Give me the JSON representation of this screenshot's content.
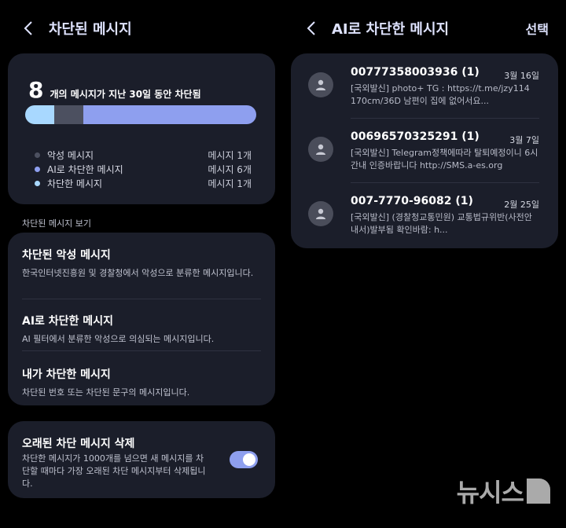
{
  "left": {
    "title": "차단된 메시지",
    "summary": {
      "count": "8",
      "count_text": "개의 메시지가 지난 30일 동안 차단됨",
      "bar_colors": {
        "spam": "#4c5060",
        "ai": "#8e9fef",
        "user": "#a8d8ff"
      },
      "bar_fractions": {
        "user": 0.125,
        "spam": 0.125,
        "ai": 0.75
      },
      "legend": [
        {
          "label": "악성 메시지",
          "count": "메시지 1개",
          "color": "#4c5060"
        },
        {
          "label": "AI로 차단한 메시지",
          "count": "메시지 6개",
          "color": "#8e9fef"
        },
        {
          "label": "차단한 메시지",
          "count": "메시지 1개",
          "color": "#a8d8ff"
        }
      ]
    },
    "section_label": "차단된 메시지 보기",
    "menu": [
      {
        "title": "차단된 악성 메시지",
        "desc": "한국인터넷진흥원 및 경찰청에서 악성으로 분류한 메시지입니다."
      },
      {
        "title": "AI로 차단한 메시지",
        "desc": "AI 필터에서 분류한 악성으로 의심되는 메시지입니다."
      },
      {
        "title": "내가 차단한 메시지",
        "desc": "차단된 번호 또는 차단된 문구의 메시지입니다."
      }
    ],
    "delete": {
      "title": "오래된 차단 메시지 삭제",
      "desc": "차단한 메시지가 1000개를 넘으면 새 메시지를 차단할 때마다 가장 오래된 차단 메시지부터 삭제됩니다.",
      "enabled": true
    }
  },
  "right": {
    "title": "AI로 차단한 메시지",
    "select_label": "선택",
    "messages": [
      {
        "sender": "00777358003936 (1)",
        "date": "3월 16일",
        "body": "[국외발신] photo+ TG : https://t.me/jzy114 170cm/36D 남편이 집에 없어서요..."
      },
      {
        "sender": "00696570325291 (1)",
        "date": "3월 7일",
        "body": "[국외발신] Telegram정책에따라 탈퇴예정이니 6시간내 인증바랍니다 http://SMS.a-es.org"
      },
      {
        "sender": "007-7770-96082 (1)",
        "date": "2월 25일",
        "body": "[국외발신] (경찰청교통민원) 교통법규위반(사전안내서)발부됨 확인바람: h..."
      }
    ]
  },
  "watermark": "뉴시스"
}
